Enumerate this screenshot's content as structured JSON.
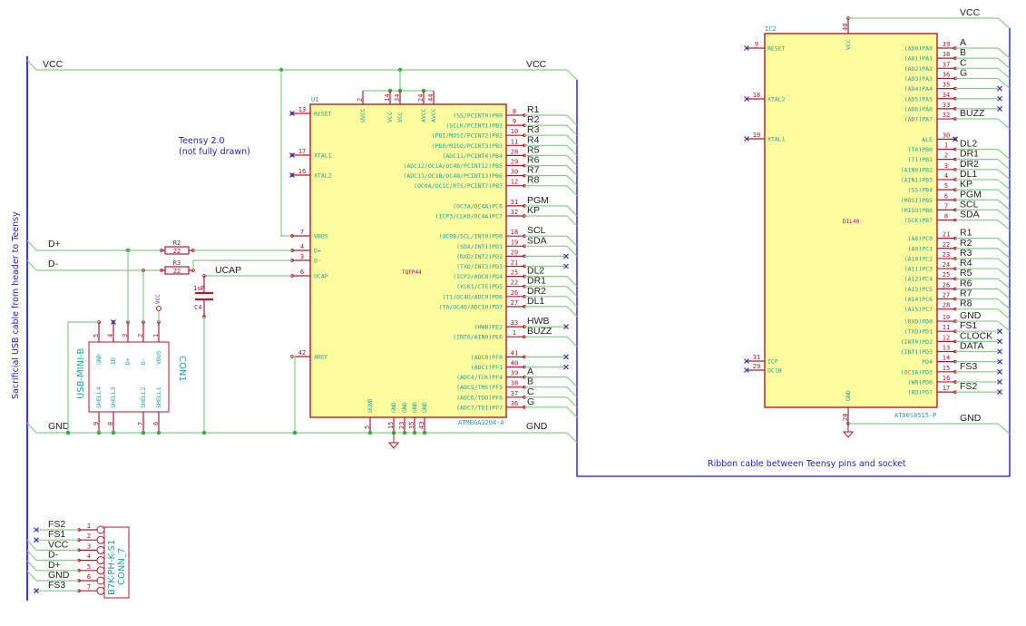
{
  "colors": {
    "wire": "#84d084",
    "bus": "#3c3cd8",
    "pin": "#b01a28",
    "body_fill": "#fcfc9e",
    "body_stroke": "#b0302a",
    "junction": "#2fae2f",
    "noconnect": "#3030c0",
    "pin_name": "#1aa3a3"
  },
  "notes": {
    "teensy": "Teensy 2.0",
    "teensy_sub": "(not fully drawn)",
    "ribbon": "Ribbon cable between Teensy pins and socket",
    "usb_cable": "Sacrificial USB cable from header to Teensy"
  },
  "nets": {
    "vcc_left": "VCC",
    "vcc_right": "VCC",
    "gnd_left": "GND",
    "gnd_right": "GND",
    "dplus": "D+",
    "dminus": "D-",
    "ucap": "UCAP",
    "ic2_vcc": "VCC",
    "ic2_gnd": "GND"
  },
  "u1": {
    "ref": "U1",
    "value": "ATMEGA32U4-A",
    "package": "TQFP44",
    "left_pins": [
      {
        "num": "13",
        "name": "RESET",
        "nc": true
      },
      {
        "num": "17",
        "name": "XTAL1",
        "nc": true
      },
      {
        "num": "16",
        "name": "XTAL2",
        "nc": true
      },
      {
        "num": "7",
        "name": "VBUS"
      },
      {
        "num": "4",
        "name": "D+"
      },
      {
        "num": "3",
        "name": "D-"
      },
      {
        "num": "6",
        "name": "UCAP"
      },
      {
        "num": "42",
        "name": "AREF"
      }
    ],
    "top_pins": [
      {
        "num": "2",
        "name": "UVCC"
      },
      {
        "num": "14",
        "name": "VCC"
      },
      {
        "num": "34",
        "name": "VCC"
      },
      {
        "num": "24",
        "name": "AVCC"
      },
      {
        "num": "44",
        "name": "AVCC"
      }
    ],
    "bottom_pins": [
      {
        "num": "5",
        "name": "UGND"
      },
      {
        "num": "15",
        "name": "GND"
      },
      {
        "num": "23",
        "name": "GND"
      },
      {
        "num": "35",
        "name": "GND"
      },
      {
        "num": "43",
        "name": "GND"
      }
    ],
    "right_pins": [
      {
        "num": "8",
        "name": "(SS/PCINT0)PB0",
        "net": "R1"
      },
      {
        "num": "9",
        "name": "(SCLK/PCINT1)PB1",
        "net": "R2"
      },
      {
        "num": "10",
        "name": "(PDI/MOSI/PCINT2)PB2",
        "net": "R3"
      },
      {
        "num": "11",
        "name": "(PDO/MISO/PCINT3)PB3",
        "net": "R4"
      },
      {
        "num": "28",
        "name": "(ADC11/PCINT4)PB4",
        "net": "R5"
      },
      {
        "num": "29",
        "name": "(ADC12/OC1A/OC4B/PCINT12)PB5",
        "net": "R6"
      },
      {
        "num": "30",
        "name": "(ADC13/OC1B/OC4B/PCINT13)PB6",
        "net": "R7"
      },
      {
        "num": "12",
        "name": "(OC0A/OC1C/RTS/PCINT7)PB7",
        "net": "R8"
      },
      {
        "num": "31",
        "name": "(OC3A/OC4A)PC6",
        "net": "PGM"
      },
      {
        "num": "32",
        "name": "(ICP3/CLK0/OC4A)PC7",
        "net": "KP"
      },
      {
        "num": "18",
        "name": "(OC0B/SCL/INT0)PD0",
        "net": "SCL"
      },
      {
        "num": "19",
        "name": "(SDA/INT1)PD1",
        "net": "SDA"
      },
      {
        "num": "20",
        "name": "(RXD/INT2)PD2",
        "nc": true
      },
      {
        "num": "21",
        "name": "(TXD/INT3)PD3",
        "nc": true
      },
      {
        "num": "25",
        "name": "(ICP2/ADC8)PD4",
        "net": "DL2"
      },
      {
        "num": "22",
        "name": "(XCK1/CTS)PD5",
        "net": "DR1"
      },
      {
        "num": "26",
        "name": "(T1/OC4D/ADC9)PD6",
        "net": "DR2"
      },
      {
        "num": "27",
        "name": "(T0/OC4D/ADC10)PD7",
        "net": "DL1"
      },
      {
        "num": "33",
        "name": "(HWB)PE2",
        "net": "HWB",
        "nc": true
      },
      {
        "num": "1",
        "name": "(INT6/AIN0)PE6",
        "net": "BUZZ"
      },
      {
        "num": "41",
        "name": "(ADC0)PF0",
        "nc": true
      },
      {
        "num": "40",
        "name": "(ADC1)PF1",
        "nc": true
      },
      {
        "num": "39",
        "name": "(ADC4/TCK)PF4",
        "net": "A"
      },
      {
        "num": "38",
        "name": "(ADC5/TMS)PF5",
        "net": "B"
      },
      {
        "num": "37",
        "name": "(ADC6/TDO)PF6",
        "net": "C"
      },
      {
        "num": "36",
        "name": "(ADC7/TDI)PF7",
        "net": "G"
      }
    ]
  },
  "ic2": {
    "ref": "IC2",
    "value": "AT90S8515-P",
    "package": "DIL40",
    "top_pin": {
      "num": "40",
      "name": "VCC"
    },
    "bottom_pin": {
      "num": "20",
      "name": "GND"
    },
    "left_pins": [
      {
        "num": "9",
        "name": "RESET"
      },
      {
        "num": "18",
        "name": "XTAL2"
      },
      {
        "num": "19",
        "name": "XTAL1"
      },
      {
        "num": "31",
        "name": "ICP"
      },
      {
        "num": "29",
        "name": "OC1B"
      }
    ],
    "right_pins": [
      {
        "num": "39",
        "name": "(AD0)PA0",
        "net": "A"
      },
      {
        "num": "38",
        "name": "(AD1)PA1",
        "net": "B"
      },
      {
        "num": "37",
        "name": "(AD2)PA2",
        "net": "C"
      },
      {
        "num": "36",
        "name": "(AD3)PA3",
        "net": "G"
      },
      {
        "num": "35",
        "name": "(AD4)PA4",
        "nc": true
      },
      {
        "num": "34",
        "name": "(AD5)PA5",
        "nc": true
      },
      {
        "num": "33",
        "name": "(AD6)PA6",
        "nc": true
      },
      {
        "num": "32",
        "name": "(AD7)PA7",
        "net": "BUZZ"
      },
      {
        "num": "30",
        "name": "ALE",
        "nc_pin": true
      },
      {
        "num": "1",
        "name": "(T0)PB0",
        "net": "DL2"
      },
      {
        "num": "2",
        "name": "(T1)PB1",
        "net": "DR1"
      },
      {
        "num": "3",
        "name": "(AIN0)PB2",
        "net": "DR2"
      },
      {
        "num": "4",
        "name": "(AIN1)PB3",
        "net": "DL1"
      },
      {
        "num": "5",
        "name": "(SS)PB4",
        "net": "KP"
      },
      {
        "num": "6",
        "name": "(MOSI)PB5",
        "net": "PGM"
      },
      {
        "num": "7",
        "name": "(MISO)PB6",
        "net": "SCL"
      },
      {
        "num": "8",
        "name": "(SCK)PB7",
        "net": "SDA"
      },
      {
        "num": "21",
        "name": "(A8)PC0",
        "net": "R1"
      },
      {
        "num": "22",
        "name": "(A9)PC1",
        "net": "R2"
      },
      {
        "num": "23",
        "name": "(A10)PC2",
        "net": "R3"
      },
      {
        "num": "24",
        "name": "(A11)PC3",
        "net": "R4"
      },
      {
        "num": "25",
        "name": "(A12)PC4",
        "net": "R5"
      },
      {
        "num": "26",
        "name": "(A13)PC5",
        "net": "R6"
      },
      {
        "num": "27",
        "name": "(A14)PC6",
        "net": "R7"
      },
      {
        "num": "28",
        "name": "(A15)PC7",
        "net": "R8"
      },
      {
        "num": "10",
        "name": "(RXD)PD0",
        "net": "GND"
      },
      {
        "num": "11",
        "name": "(TXD)PD1",
        "net": "FS1",
        "nc": true
      },
      {
        "num": "12",
        "name": "(INT0)PD2",
        "net": "CLOCK",
        "nc": true
      },
      {
        "num": "13",
        "name": "(INT1)PD3",
        "net": "DATA",
        "nc": true
      },
      {
        "num": "14",
        "name": "PD4",
        "nc": true
      },
      {
        "num": "15",
        "name": "(OC1A)PD5",
        "net": "FS3",
        "nc": true
      },
      {
        "num": "16",
        "name": "(WR)PD6",
        "nc": true
      },
      {
        "num": "17",
        "name": "(RD)PD7",
        "net": "FS2",
        "nc": true
      }
    ]
  },
  "con1": {
    "ref": "CON1",
    "value": "USB-MINI-B",
    "vbus_symbol": "VCC",
    "top_pins": [
      {
        "num": "5",
        "name": "GND"
      },
      {
        "num": "4",
        "name": "ID"
      },
      {
        "num": "3",
        "name": "D+"
      },
      {
        "num": "2",
        "name": "D-"
      },
      {
        "num": "1",
        "name": "VBUS"
      }
    ],
    "bottom_pins": [
      {
        "num": "9",
        "name": "SHELL4"
      },
      {
        "num": "8",
        "name": "SHELL3"
      },
      {
        "num": "7",
        "name": "SHELL2"
      },
      {
        "num": "6",
        "name": "SHELL1"
      }
    ]
  },
  "r2": {
    "ref": "R2",
    "value": "22"
  },
  "r3": {
    "ref": "R3",
    "value": "22"
  },
  "c4": {
    "ref": "C4",
    "value": "1uF"
  },
  "conn7": {
    "ref": "CONN_7",
    "value": "B7K-PH-K-S1",
    "pins": [
      {
        "num": "1",
        "net": "FS2",
        "nc": true
      },
      {
        "num": "2",
        "net": "FS1",
        "nc": true
      },
      {
        "num": "3",
        "net": "VCC"
      },
      {
        "num": "4",
        "net": "D-"
      },
      {
        "num": "5",
        "net": "D+"
      },
      {
        "num": "6",
        "net": "GND"
      },
      {
        "num": "7",
        "net": "FS3",
        "nc": true
      }
    ]
  }
}
